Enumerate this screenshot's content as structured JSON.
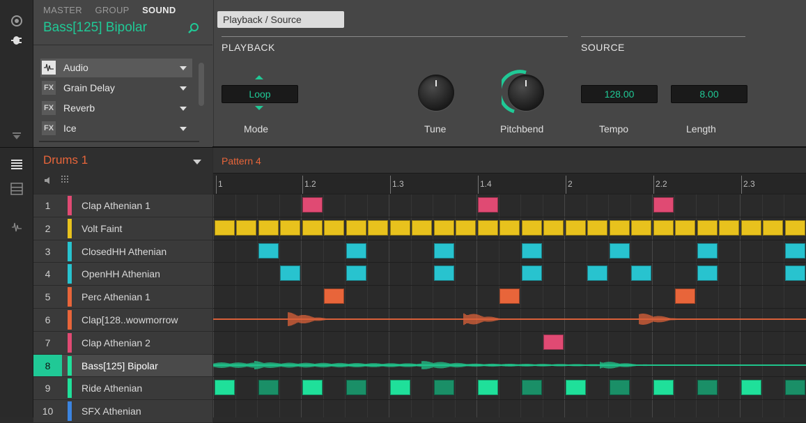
{
  "header": {
    "tabs": [
      "MASTER",
      "GROUP",
      "SOUND"
    ],
    "sound_name": "Bass[125] Bipolar",
    "search_icon": "search-icon",
    "plugin_slots": [
      {
        "icon": "Audio",
        "label": "Audio"
      },
      {
        "icon": "FX",
        "label": "Grain Delay"
      },
      {
        "icon": "FX",
        "label": "Reverb"
      },
      {
        "icon": "FX",
        "label": "Ice"
      }
    ],
    "page_tab": "Playback / Source",
    "sections": {
      "playback": "PLAYBACK",
      "source": "SOURCE"
    },
    "params": {
      "mode": {
        "label": "Mode",
        "value": "Loop"
      },
      "tune": {
        "label": "Tune"
      },
      "pitchbend": {
        "label": "Pitchbend"
      },
      "tempo": {
        "label": "Tempo",
        "value": "128.00"
      },
      "length": {
        "label": "Length",
        "value": "8.00"
      }
    }
  },
  "group": {
    "name": "Drums 1"
  },
  "pattern": {
    "name": "Pattern 4",
    "ruler": [
      "1",
      "1.2",
      "1.3",
      "1.4",
      "2",
      "2.2",
      "2.3"
    ]
  },
  "sounds": [
    {
      "num": "1",
      "name": "Clap Athenian 1",
      "color": "#e04a73"
    },
    {
      "num": "2",
      "name": "Volt Faint",
      "color": "#e8c21d"
    },
    {
      "num": "3",
      "name": "ClosedHH Athenian",
      "color": "#28c3cf"
    },
    {
      "num": "4",
      "name": "OpenHH Athenian",
      "color": "#28c3cf"
    },
    {
      "num": "5",
      "name": "Perc Athenian 1",
      "color": "#e8653a"
    },
    {
      "num": "6",
      "name": "Clap[128..wowmorrow",
      "color": "#e8653a"
    },
    {
      "num": "7",
      "name": "Clap Athenian 2",
      "color": "#e04a73"
    },
    {
      "num": "8",
      "name": "Bass[125] Bipolar",
      "color": "#1fe09a"
    },
    {
      "num": "9",
      "name": "Ride Athenian",
      "color": "#1fe09a"
    },
    {
      "num": "10",
      "name": "SFX Athenian",
      "color": "#3b84e0"
    }
  ],
  "colors": {
    "accent": "#20c996",
    "group": "#e8653a"
  }
}
